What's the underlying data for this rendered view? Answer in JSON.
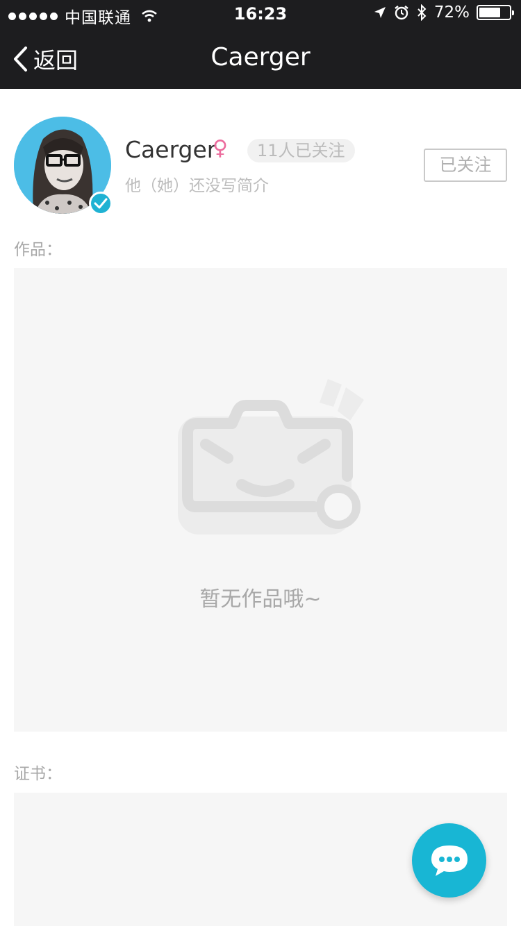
{
  "status_bar": {
    "carrier": "中国联通",
    "time": "16:23",
    "battery": "72%",
    "battery_level": 0.72
  },
  "nav": {
    "back_label": "返回",
    "title": "Caerger"
  },
  "profile": {
    "name": "Caerger",
    "gender_symbol": "♀",
    "followers": "11人已关注",
    "bio": "他（她）还没写简介",
    "follow_button": "已关注"
  },
  "works": {
    "label": "作品：",
    "empty_text": "暂无作品哦~"
  },
  "certificates": {
    "label": "证书："
  },
  "icons": [
    "chevron-left-icon",
    "wifi-icon",
    "location-icon",
    "alarm-icon",
    "bluetooth-icon",
    "battery-icon",
    "verified-icon",
    "chat-icon"
  ],
  "colors": {
    "nav_bg": "#1d1d1f",
    "accent": "#18b6d4",
    "gender": "#ec6c9d"
  }
}
